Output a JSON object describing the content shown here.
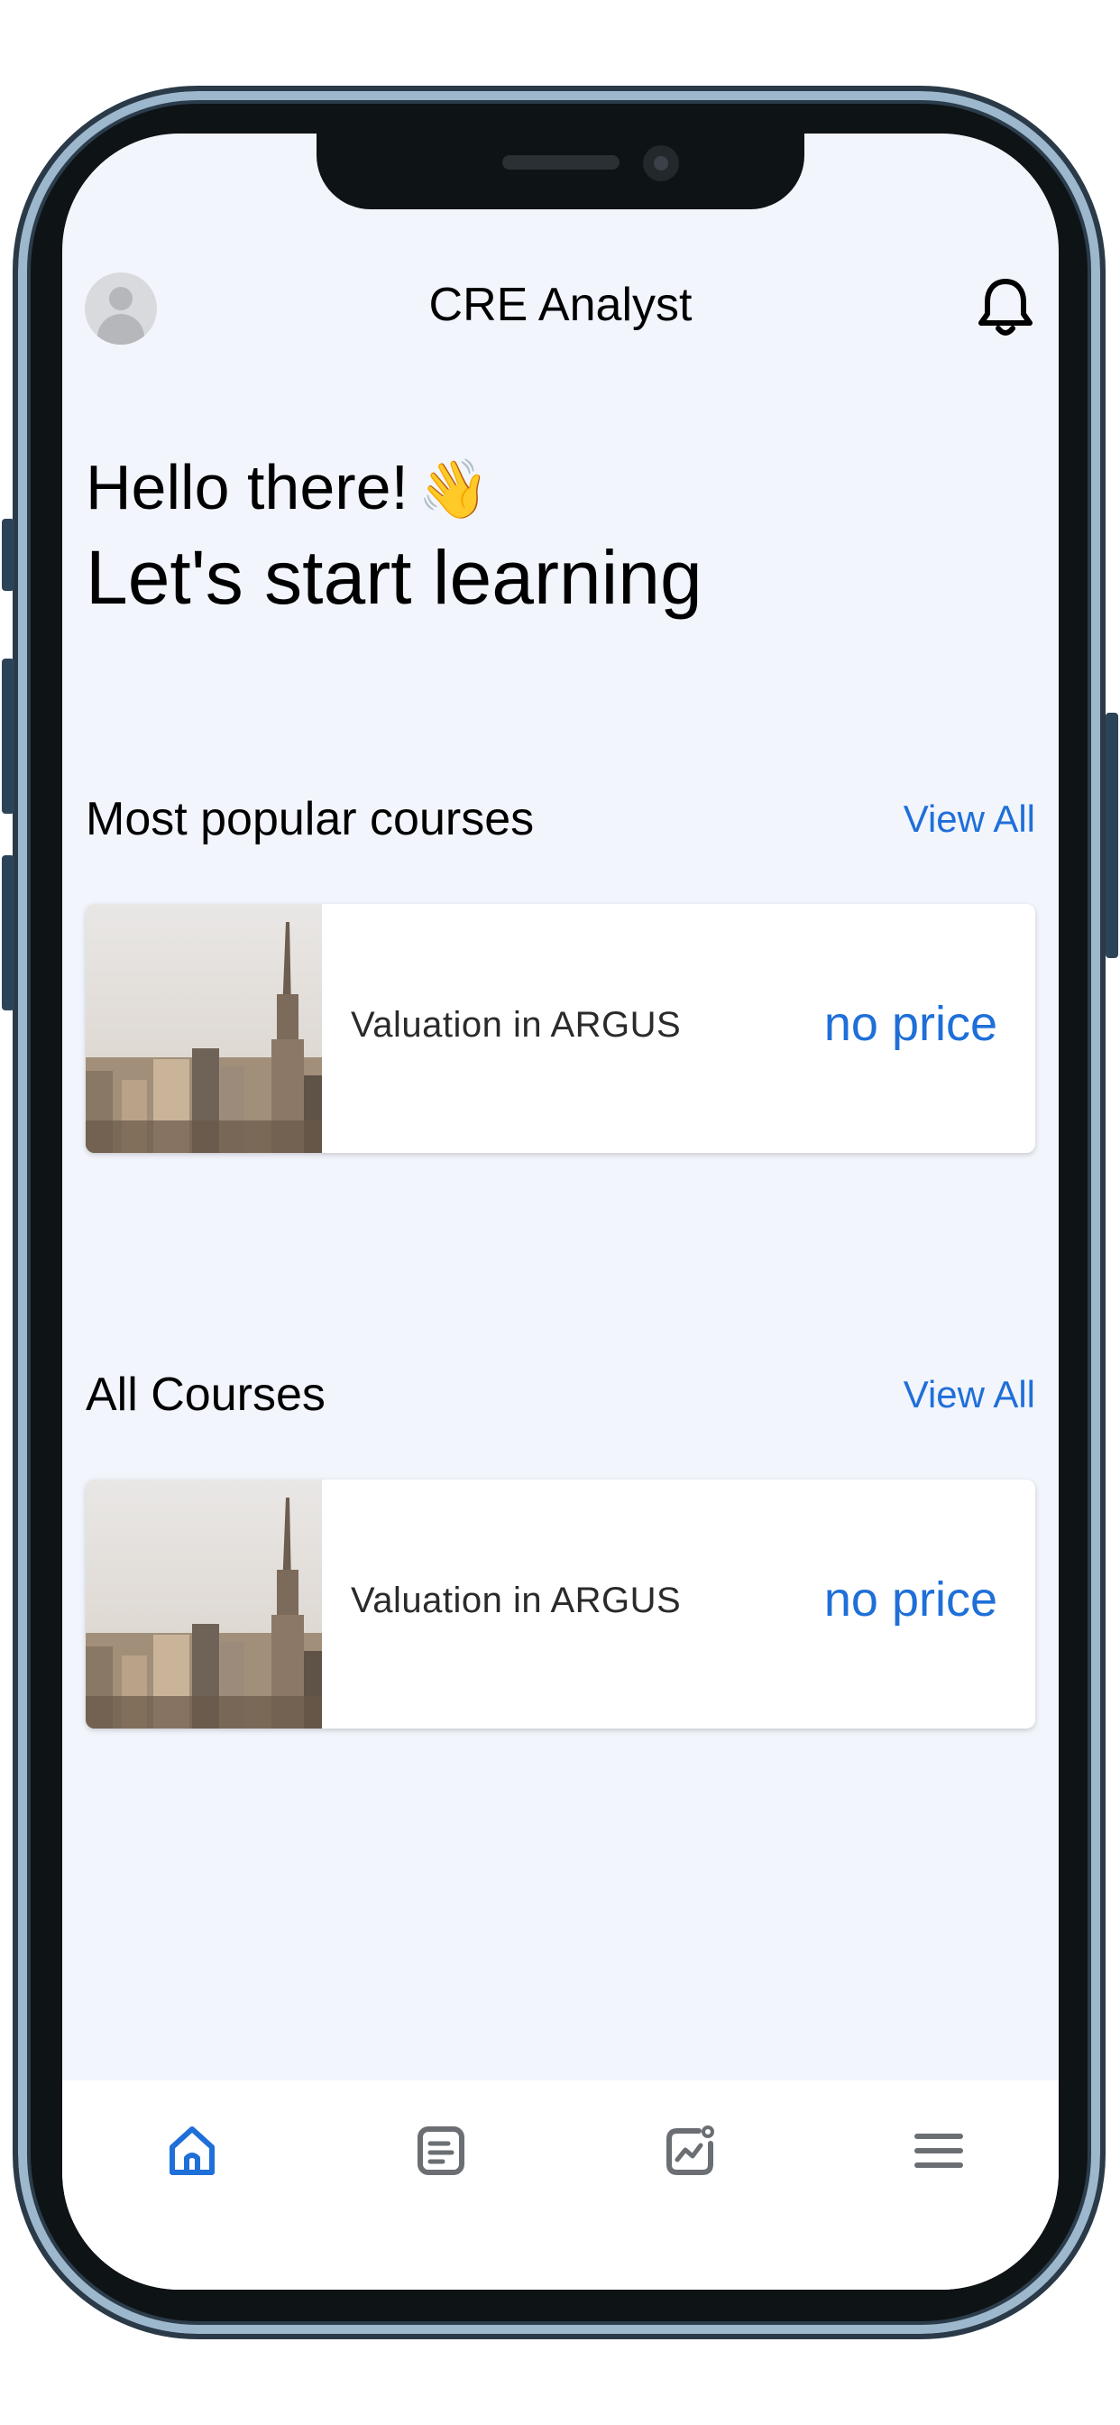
{
  "header": {
    "title": "CRE Analyst",
    "avatar_icon": "avatar-placeholder-icon",
    "notification_icon": "bell-icon"
  },
  "greeting": {
    "line1": "Hello there!",
    "emoji": "👋",
    "line2": "Let's start learning"
  },
  "popular": {
    "title": "Most popular courses",
    "view_all": "View All",
    "courses": [
      {
        "name": "Valuation in ARGUS",
        "price": "no price",
        "image": "city-skyline-photo"
      }
    ]
  },
  "all_courses": {
    "title": "All Courses",
    "view_all": "View All",
    "courses": [
      {
        "name": "Valuation in ARGUS",
        "price": "no price",
        "image": "city-skyline-photo"
      }
    ]
  },
  "bottom_nav": {
    "items": [
      {
        "icon": "home-icon",
        "active": true
      },
      {
        "icon": "document-icon",
        "active": false
      },
      {
        "icon": "analytics-icon",
        "active": false
      },
      {
        "icon": "menu-icon",
        "active": false
      }
    ]
  },
  "colors": {
    "accent": "#1f6fd9",
    "screen_background": "#f2f5fc",
    "card_background": "#ffffff",
    "inactive_icon": "#6b6f73"
  }
}
